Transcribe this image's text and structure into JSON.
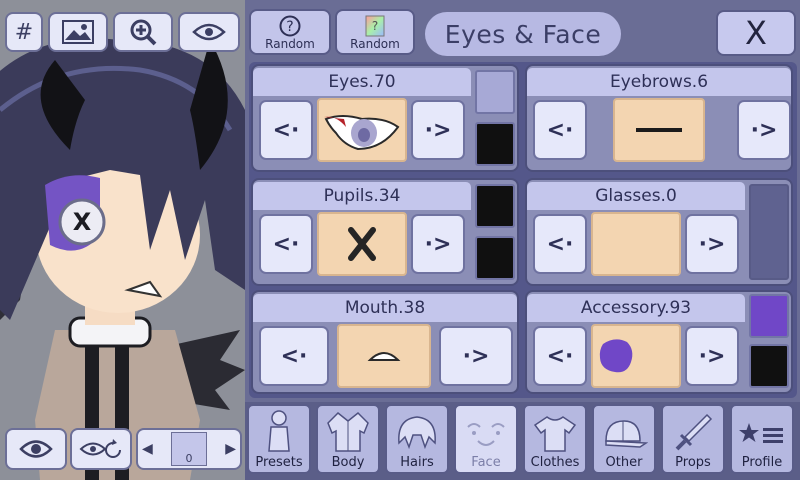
{
  "left_toolbar": {
    "hash_label": "#",
    "icons": [
      "image-icon",
      "zoom-in-icon",
      "eye-icon"
    ]
  },
  "left_bottom": {
    "page_number": "0"
  },
  "header": {
    "random1_label": "Random",
    "random2_label": "Random",
    "title": "Eyes & Face",
    "close_label": "X"
  },
  "features": {
    "eyes": "Eyes.70",
    "eyebrows": "Eyebrows.6",
    "pupils": "Pupils.34",
    "glasses": "Glasses.0",
    "mouth": "Mouth.38",
    "accessory": "Accessory.93",
    "prev_glyph": "<·",
    "next_glyph": "·>"
  },
  "swatch_colors": {
    "eyes_top": "#a7a9d6",
    "eyes_bottom": "#101010",
    "pupils_top": "#101010",
    "pupils_bottom": "#101010",
    "accessory_top": "#7047c7",
    "accessory_bottom": "#101010"
  },
  "nav": {
    "items": [
      {
        "label": "Presets",
        "icon": "person-icon"
      },
      {
        "label": "Body",
        "icon": "jacket-icon"
      },
      {
        "label": "Hairs",
        "icon": "hair-icon"
      },
      {
        "label": "Face",
        "icon": "face-icon"
      },
      {
        "label": "Clothes",
        "icon": "shirt-icon"
      },
      {
        "label": "Other",
        "icon": "cap-icon"
      },
      {
        "label": "Props",
        "icon": "sword-icon"
      },
      {
        "label": "Profile",
        "icon": "star-list-icon"
      }
    ],
    "active": "Face"
  }
}
